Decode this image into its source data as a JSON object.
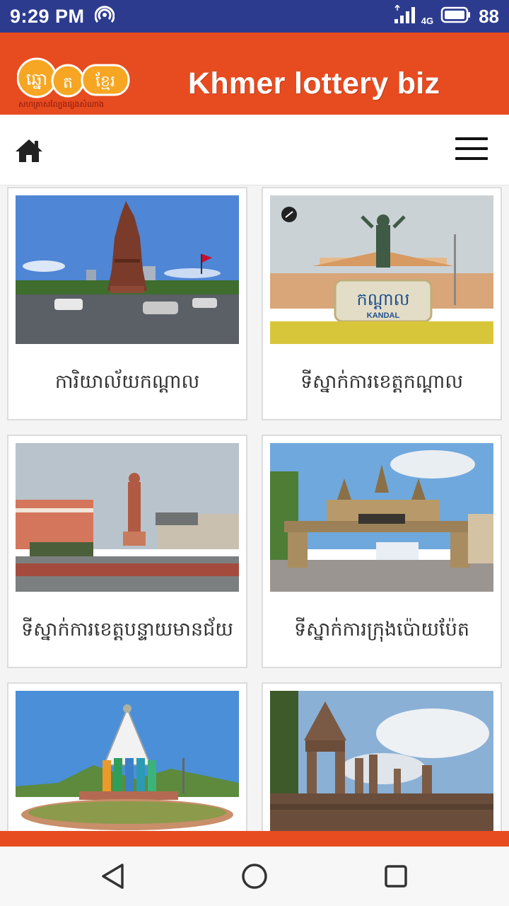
{
  "status_bar": {
    "time": "9:29 PM",
    "network": "4G",
    "battery": "88"
  },
  "header": {
    "title": "Khmer lottery biz",
    "logo_text": "ឆ្នោតខ្មែរ",
    "logo_subtext": "សហគ្រាសល្បែងផ្សងសំណាង"
  },
  "nav": {
    "home_icon": "home-icon",
    "menu_icon": "hamburger-menu-icon"
  },
  "cards": [
    {
      "label": "ការិយាល័យកណ្តាល",
      "image": "independence-monument-photo"
    },
    {
      "label": "ទីស្នាក់ការខេត្តកណ្តាល",
      "image": "kandal-statue-photo",
      "image_sign": "កណ្ដាល",
      "image_sign_latin": "KANDAL"
    },
    {
      "label": "ទីស្នាក់ការខេត្តបន្ទាយមានជ័យ",
      "image": "banteay-meanchey-statue-photo"
    },
    {
      "label": "ទីស្នាក់ការក្រុងប៉ោយប៉ែត",
      "image": "poipet-gate-photo"
    },
    {
      "label": "",
      "image": "roundabout-statue-photo"
    },
    {
      "label": "",
      "image": "preah-vihear-temple-photo"
    }
  ],
  "colors": {
    "status_bar": "#2d3b8f",
    "brand": "#e74b20",
    "card_border": "#dcdcdc"
  },
  "system_nav": {
    "back": "back-triangle-icon",
    "home": "home-circle-icon",
    "recents": "recents-square-icon"
  }
}
